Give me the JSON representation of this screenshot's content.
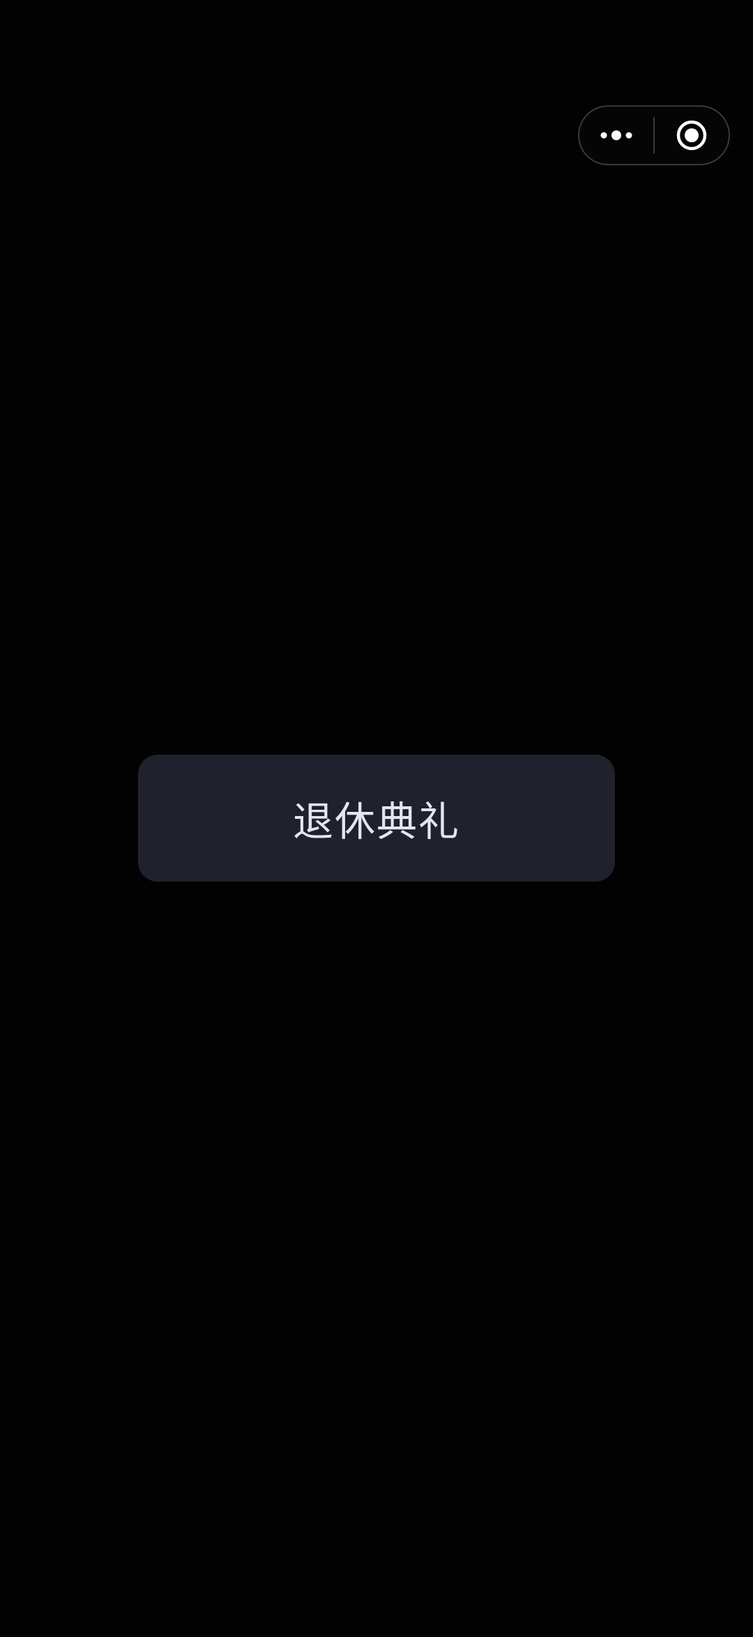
{
  "capsule": {
    "more_icon": "more-dots-icon",
    "close_icon": "target-close-icon"
  },
  "main": {
    "button_label": "退休典礼"
  },
  "colors": {
    "background": "#020202",
    "button_bg": "#1f222c",
    "button_text": "#e3e6ee",
    "capsule_border": "#3a3a3a"
  }
}
